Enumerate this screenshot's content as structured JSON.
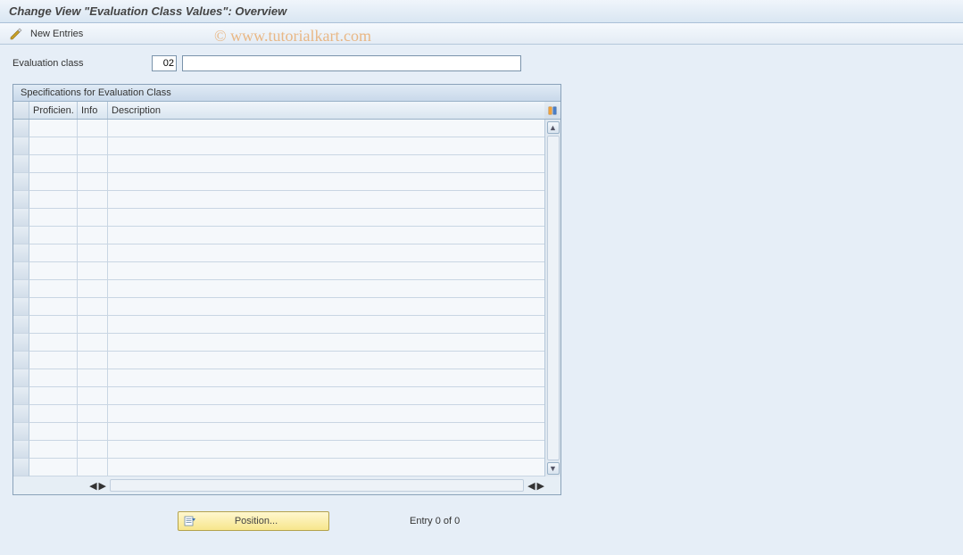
{
  "title": "Change View \"Evaluation Class Values\": Overview",
  "toolbar": {
    "new_entries": "New Entries"
  },
  "fields": {
    "evaluation_class_label": "Evaluation class",
    "evaluation_class_value": "02",
    "evaluation_class_desc": ""
  },
  "grid": {
    "title": "Specifications for Evaluation Class",
    "columns": {
      "proficiency": "Proficien.",
      "info": "Info",
      "description": "Description"
    },
    "row_count": 20,
    "rows": []
  },
  "footer": {
    "position_label": "Position...",
    "entry_text": "Entry 0 of 0"
  },
  "watermark": "© www.tutorialkart.com",
  "chart_data": {
    "type": "table",
    "title": "Specifications for Evaluation Class",
    "columns": [
      "Proficien.",
      "Info",
      "Description"
    ],
    "rows": []
  }
}
